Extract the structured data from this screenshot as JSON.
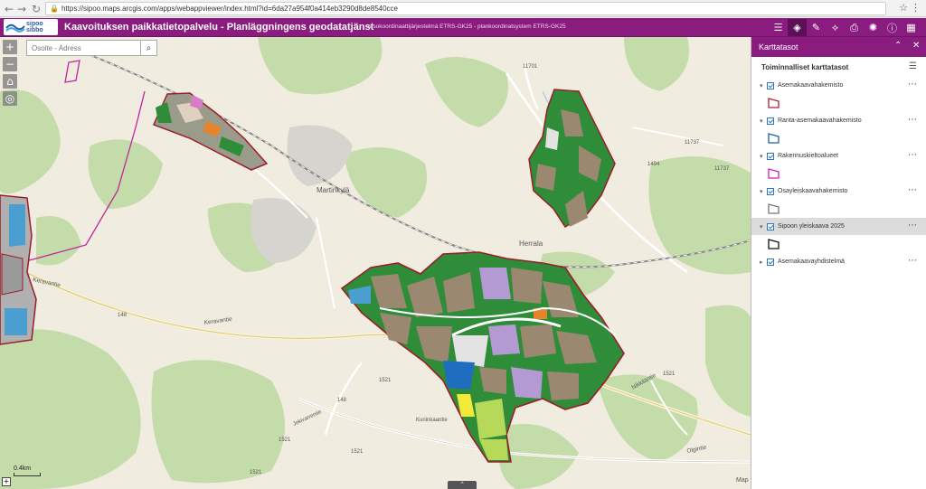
{
  "browser": {
    "url": "https://sipoo.maps.arcgis.com/apps/webappviewer/index.html?id=6da27a954f0a414eb3290d8de8540cce"
  },
  "header": {
    "logo_line1": "sipoo",
    "logo_line2": "sibbo",
    "title": "Kaavoituksen paikkatietopalvelu  -  Planläggningens geodatatjänst",
    "coord_text": "tasokoordinaattijärjestelmä ETRS-GK25 - plankoordinatsystem ETRS-GK25"
  },
  "search": {
    "placeholder": "Osoite - Adress"
  },
  "map": {
    "scale_label": "0.4km",
    "attribution": "Map",
    "place_labels": {
      "martinkyla": "Martinkylä",
      "herrala": "Herrala",
      "keravantie1": "Keravantie",
      "keravantie2": "Keravantie",
      "nikkilantie": "Nikkiläntie",
      "olgintie": "Olgintie",
      "kuninkaantie": "Kuninkaantie",
      "jokivarrentie": "Jokivarrentie",
      "r11701": "11701",
      "r11737a": "11737",
      "r11737b": "11737",
      "r1494": "1494",
      "r148a": "148",
      "r148b": "148",
      "r1521a": "1521",
      "r1521b": "1521",
      "r1521c": "1521",
      "r1521d": "1521",
      "r1521e": "1521"
    }
  },
  "panel": {
    "title": "Karttatasot",
    "section_title": "Toiminnalliset karttatasot",
    "layers": [
      {
        "name": "Asemakaavahakemisto",
        "legend_color": "#b02030"
      },
      {
        "name": "Ranta-asemakaavahakemisto",
        "legend_color": "#1f5fa8"
      },
      {
        "name": "Rakennuskieltoalueet",
        "legend_color": "#d020b0"
      },
      {
        "name": "Osayleiskaavahakemisto",
        "legend_color": "#777777"
      },
      {
        "name": "Sipoon yleiskaava 2025",
        "legend_color": "#111111"
      },
      {
        "name": "Asemakaavayhdistelmä",
        "legend_color": ""
      }
    ]
  }
}
